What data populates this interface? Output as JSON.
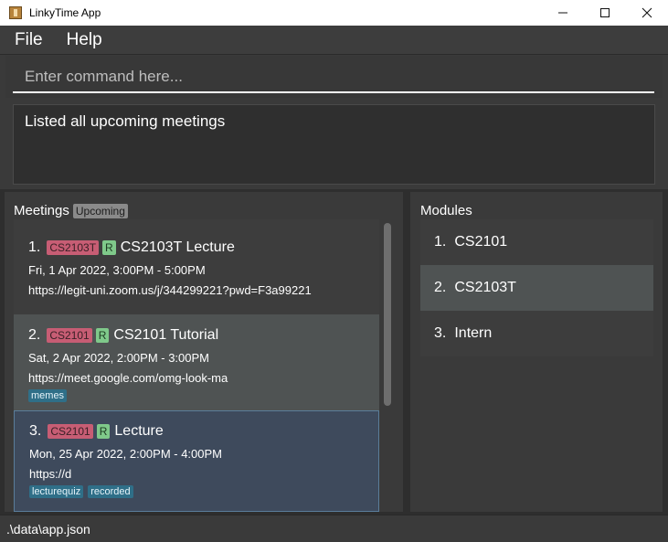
{
  "window": {
    "title": "LinkyTime App"
  },
  "menu": {
    "file": "File",
    "help": "Help"
  },
  "command": {
    "placeholder": "Enter command here..."
  },
  "result": {
    "text": "Listed all upcoming meetings"
  },
  "meetings": {
    "header": "Meetings",
    "filter_badge": "Upcoming",
    "items": [
      {
        "index": "1.",
        "module": "CS2103T",
        "recurring": "R",
        "title": "CS2103T Lecture",
        "time": "Fri, 1 Apr 2022, 3:00PM  -  5:00PM",
        "link": "https://legit-uni.zoom.us/j/344299221?pwd=F3a99221",
        "tags": []
      },
      {
        "index": "2.",
        "module": "CS2101",
        "recurring": "R",
        "title": "CS2101 Tutorial",
        "time": "Sat, 2 Apr 2022, 2:00PM  -  3:00PM",
        "link": "https://meet.google.com/omg-look-ma",
        "tags": [
          "memes"
        ]
      },
      {
        "index": "3.",
        "module": "CS2101",
        "recurring": "R",
        "title": "Lecture",
        "time": "Mon, 25 Apr 2022, 2:00PM  -  4:00PM",
        "link": "https://d",
        "tags": [
          "lecturequiz",
          "recorded"
        ]
      }
    ]
  },
  "modules": {
    "header": "Modules",
    "items": [
      {
        "index": "1.",
        "name": "CS2101"
      },
      {
        "index": "2.",
        "name": "CS2103T"
      },
      {
        "index": "3.",
        "name": "Intern"
      }
    ]
  },
  "status": {
    "file_path": ".\\data\\app.json"
  },
  "colors": {
    "module_tag": "#c75d74",
    "recurring_tag": "#7fc98a",
    "tag": "#2f6f88",
    "selected_row": "#4f5353",
    "focused_card": "#3e4a5c"
  }
}
